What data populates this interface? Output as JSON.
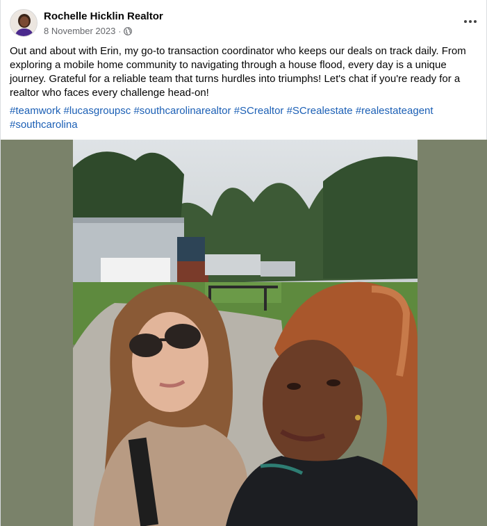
{
  "post": {
    "author": "Rochelle Hicklin Realtor",
    "date": "8 November 2023",
    "separator": "·",
    "privacy_icon": "globe-icon",
    "more_icon": "ellipsis-icon",
    "text": "Out and about with Erin, my go-to transaction coordinator who keeps our deals on track daily. From exploring a mobile home community to navigating through a house flood, every day is a unique journey. Grateful for a reliable team that turns hurdles into triumphs! Let's chat if you're ready for a realtor who faces every challenge head-on!",
    "hashtags": [
      "#teamwork",
      "#lucasgroupsc",
      "#southcarolinarealtor",
      "#SCrealtor",
      "#SCrealestate",
      "#realestateagent",
      "#southcarolina"
    ]
  },
  "colors": {
    "link": "#1b5fb5",
    "meta_text": "#65676b",
    "media_backdrop": "#7a826a"
  }
}
